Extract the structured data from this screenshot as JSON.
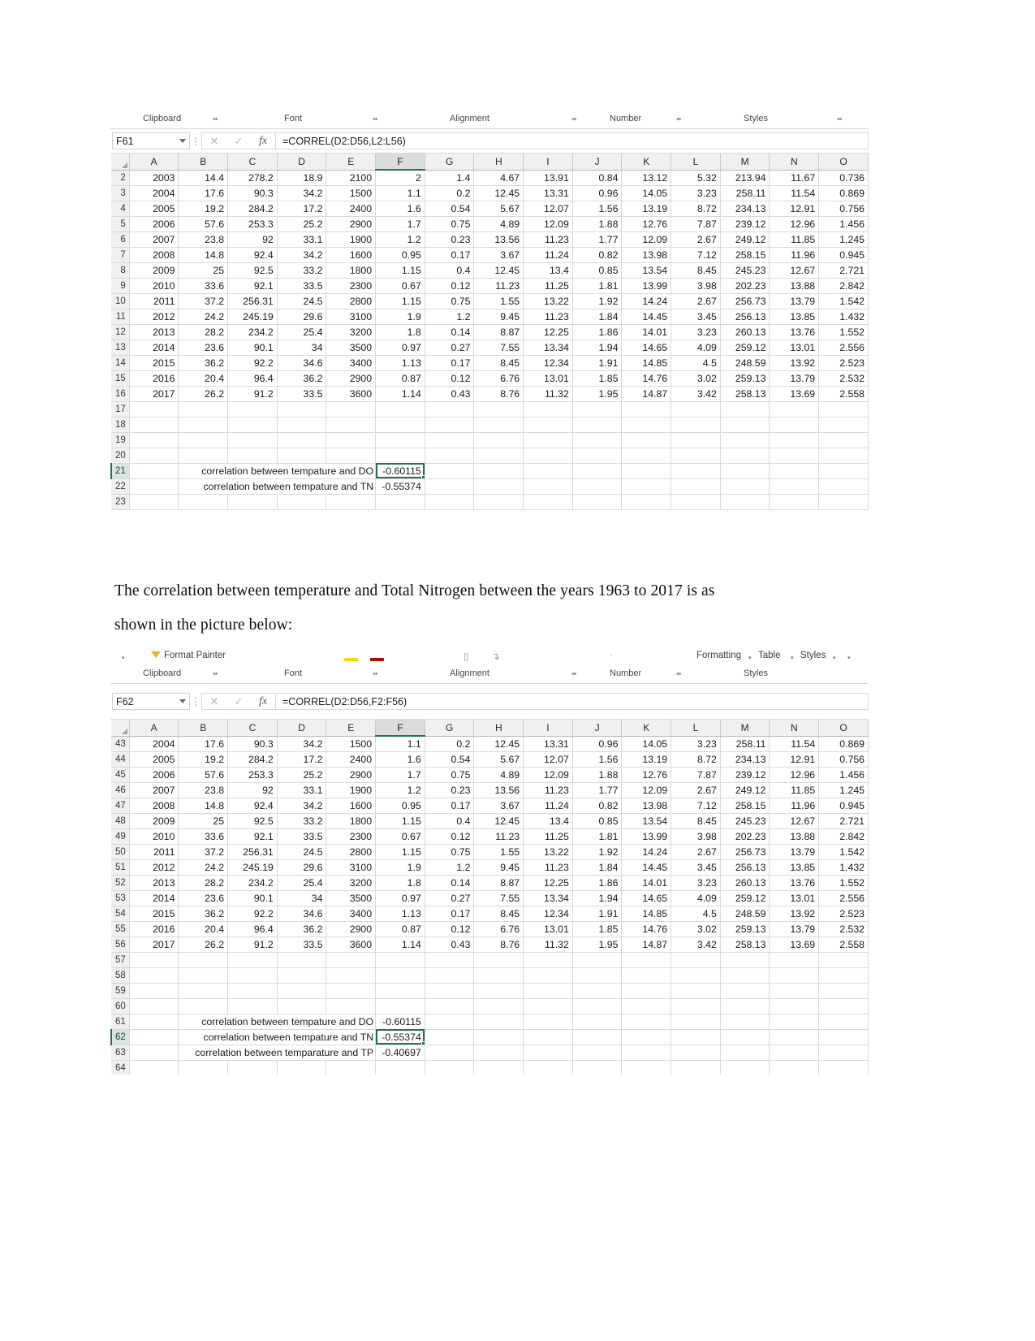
{
  "document": {
    "paragraph_line1": "The correlation between temperature and Total Nitrogen between the years 1963 to 2017 is as",
    "paragraph_line2": "shown in the picture below:"
  },
  "ribbon": {
    "group_clipboard": "Clipboard",
    "group_font": "Font",
    "group_alignment": "Alignment",
    "group_number": "Number",
    "group_styles": "Styles",
    "format_painter": "Format Painter",
    "conditional_formatting": "Formatting",
    "format_as_table": "Table",
    "cell_styles": "Styles",
    "launcher_glyph": "⬌",
    "caret_glyph": "▾",
    "colors": {
      "highlight_yellow": "#ffd400",
      "font_red": "#c00000",
      "accent_green": "#217346"
    }
  },
  "formula_bar": {
    "cancel_glyph": "✕",
    "confirm_glyph": "✓",
    "fx_glyph": "fx",
    "dots_glyph": "⋮"
  },
  "sheet1": {
    "name_box": "F61",
    "formula": "=CORREL(D2:D56,L2:L56)",
    "selected_column": "F",
    "columns": [
      "A",
      "B",
      "C",
      "D",
      "E",
      "F",
      "G",
      "H",
      "I",
      "J",
      "K",
      "L",
      "M",
      "N",
      "O"
    ],
    "row_numbers": [
      "2",
      "3",
      "4",
      "5",
      "6",
      "7",
      "8",
      "9",
      "10",
      "11",
      "12",
      "13",
      "14",
      "15",
      "16",
      "17",
      "18",
      "19",
      "20",
      "21",
      "22",
      "23"
    ],
    "rows": [
      [
        "2003",
        "14.4",
        "278.2",
        "18.9",
        "2100",
        "2",
        "1.4",
        "4.67",
        "13.91",
        "0.84",
        "13.12",
        "5.32",
        "213.94",
        "11.67",
        "0.736"
      ],
      [
        "2004",
        "17.6",
        "90.3",
        "34.2",
        "1500",
        "1.1",
        "0.2",
        "12.45",
        "13.31",
        "0.96",
        "14.05",
        "3.23",
        "258.11",
        "11.54",
        "0.869"
      ],
      [
        "2005",
        "19.2",
        "284.2",
        "17.2",
        "2400",
        "1.6",
        "0.54",
        "5.67",
        "12.07",
        "1.56",
        "13.19",
        "8.72",
        "234.13",
        "12.91",
        "0.756"
      ],
      [
        "2006",
        "57.6",
        "253.3",
        "25.2",
        "2900",
        "1.7",
        "0.75",
        "4.89",
        "12.09",
        "1.88",
        "12.76",
        "7.87",
        "239.12",
        "12.96",
        "1.456"
      ],
      [
        "2007",
        "23.8",
        "92",
        "33.1",
        "1900",
        "1.2",
        "0.23",
        "13.56",
        "11.23",
        "1.77",
        "12.09",
        "2.67",
        "249.12",
        "11.85",
        "1.245"
      ],
      [
        "2008",
        "14.8",
        "92.4",
        "34.2",
        "1600",
        "0.95",
        "0.17",
        "3.67",
        "11.24",
        "0.82",
        "13.98",
        "7.12",
        "258.15",
        "11.96",
        "0.945"
      ],
      [
        "2009",
        "25",
        "92.5",
        "33.2",
        "1800",
        "1.15",
        "0.4",
        "12.45",
        "13.4",
        "0.85",
        "13.54",
        "8.45",
        "245.23",
        "12.67",
        "2.721"
      ],
      [
        "2010",
        "33.6",
        "92.1",
        "33.5",
        "2300",
        "0.67",
        "0.12",
        "11.23",
        "11.25",
        "1.81",
        "13.99",
        "3.98",
        "202.23",
        "13.88",
        "2.842"
      ],
      [
        "2011",
        "37.2",
        "256.31",
        "24.5",
        "2800",
        "1.15",
        "0.75",
        "1.55",
        "13.22",
        "1.92",
        "14.24",
        "2.67",
        "256.73",
        "13.79",
        "1.542"
      ],
      [
        "2012",
        "24.2",
        "245.19",
        "29.6",
        "3100",
        "1.9",
        "1.2",
        "9.45",
        "11.23",
        "1.84",
        "14.45",
        "3.45",
        "256.13",
        "13.85",
        "1.432"
      ],
      [
        "2013",
        "28.2",
        "234.2",
        "25.4",
        "3200",
        "1.8",
        "0.14",
        "8.87",
        "12.25",
        "1.86",
        "14.01",
        "3.23",
        "260.13",
        "13.76",
        "1.552"
      ],
      [
        "2014",
        "23.6",
        "90.1",
        "34",
        "3500",
        "0.97",
        "0.27",
        "7.55",
        "13.34",
        "1.94",
        "14.65",
        "4.09",
        "259.12",
        "13.01",
        "2.556"
      ],
      [
        "2015",
        "36.2",
        "92.2",
        "34.6",
        "3400",
        "1.13",
        "0.17",
        "8.45",
        "12.34",
        "1.91",
        "14.85",
        "4.5",
        "248.59",
        "13.92",
        "2.523"
      ],
      [
        "2016",
        "20.4",
        "96.4",
        "36.2",
        "2900",
        "0.87",
        "0.12",
        "6.76",
        "13.01",
        "1.85",
        "14.76",
        "3.02",
        "259.13",
        "13.79",
        "2.532"
      ],
      [
        "2017",
        "26.2",
        "91.2",
        "33.5",
        "3600",
        "1.14",
        "0.43",
        "8.76",
        "11.32",
        "1.95",
        "14.87",
        "3.42",
        "258.13",
        "13.69",
        "2.558"
      ]
    ],
    "summary": [
      {
        "label": "correlation between tempature and DO",
        "value": "-0.60115",
        "selected": true
      },
      {
        "label": "correlation between tempature and TN",
        "value": "-0.55374",
        "selected": false
      }
    ]
  },
  "sheet2": {
    "name_box": "F62",
    "formula": "=CORREL(D2:D56,F2:F56)",
    "selected_column": "F",
    "columns": [
      "A",
      "B",
      "C",
      "D",
      "E",
      "F",
      "G",
      "H",
      "I",
      "J",
      "K",
      "L",
      "M",
      "N",
      "O"
    ],
    "row_numbers": [
      "43",
      "44",
      "45",
      "46",
      "47",
      "48",
      "49",
      "50",
      "51",
      "52",
      "53",
      "54",
      "55",
      "56",
      "57",
      "58",
      "59",
      "60",
      "61",
      "62",
      "63",
      "64"
    ],
    "rows": [
      [
        "2004",
        "17.6",
        "90.3",
        "34.2",
        "1500",
        "1.1",
        "0.2",
        "12.45",
        "13.31",
        "0.96",
        "14.05",
        "3.23",
        "258.11",
        "11.54",
        "0.869"
      ],
      [
        "2005",
        "19.2",
        "284.2",
        "17.2",
        "2400",
        "1.6",
        "0.54",
        "5.67",
        "12.07",
        "1.56",
        "13.19",
        "8.72",
        "234.13",
        "12.91",
        "0.756"
      ],
      [
        "2006",
        "57.6",
        "253.3",
        "25.2",
        "2900",
        "1.7",
        "0.75",
        "4.89",
        "12.09",
        "1.88",
        "12.76",
        "7.87",
        "239.12",
        "12.96",
        "1.456"
      ],
      [
        "2007",
        "23.8",
        "92",
        "33.1",
        "1900",
        "1.2",
        "0.23",
        "13.56",
        "11.23",
        "1.77",
        "12.09",
        "2.67",
        "249.12",
        "11.85",
        "1.245"
      ],
      [
        "2008",
        "14.8",
        "92.4",
        "34.2",
        "1600",
        "0.95",
        "0.17",
        "3.67",
        "11.24",
        "0.82",
        "13.98",
        "7.12",
        "258.15",
        "11.96",
        "0.945"
      ],
      [
        "2009",
        "25",
        "92.5",
        "33.2",
        "1800",
        "1.15",
        "0.4",
        "12.45",
        "13.4",
        "0.85",
        "13.54",
        "8.45",
        "245.23",
        "12.67",
        "2.721"
      ],
      [
        "2010",
        "33.6",
        "92.1",
        "33.5",
        "2300",
        "0.67",
        "0.12",
        "11.23",
        "11.25",
        "1.81",
        "13.99",
        "3.98",
        "202.23",
        "13.88",
        "2.842"
      ],
      [
        "2011",
        "37.2",
        "256.31",
        "24.5",
        "2800",
        "1.15",
        "0.75",
        "1.55",
        "13.22",
        "1.92",
        "14.24",
        "2.67",
        "256.73",
        "13.79",
        "1.542"
      ],
      [
        "2012",
        "24.2",
        "245.19",
        "29.6",
        "3100",
        "1.9",
        "1.2",
        "9.45",
        "11.23",
        "1.84",
        "14.45",
        "3.45",
        "256.13",
        "13.85",
        "1.432"
      ],
      [
        "2013",
        "28.2",
        "234.2",
        "25.4",
        "3200",
        "1.8",
        "0.14",
        "8.87",
        "12.25",
        "1.86",
        "14.01",
        "3.23",
        "260.13",
        "13.76",
        "1.552"
      ],
      [
        "2014",
        "23.6",
        "90.1",
        "34",
        "3500",
        "0.97",
        "0.27",
        "7.55",
        "13.34",
        "1.94",
        "14.65",
        "4.09",
        "259.12",
        "13.01",
        "2.556"
      ],
      [
        "2015",
        "36.2",
        "92.2",
        "34.6",
        "3400",
        "1.13",
        "0.17",
        "8.45",
        "12.34",
        "1.91",
        "14.85",
        "4.5",
        "248.59",
        "13.92",
        "2.523"
      ],
      [
        "2016",
        "20.4",
        "96.4",
        "36.2",
        "2900",
        "0.87",
        "0.12",
        "6.76",
        "13.01",
        "1.85",
        "14.76",
        "3.02",
        "259.13",
        "13.79",
        "2.532"
      ],
      [
        "2017",
        "26.2",
        "91.2",
        "33.5",
        "3600",
        "1.14",
        "0.43",
        "8.76",
        "11.32",
        "1.95",
        "14.87",
        "3.42",
        "258.13",
        "13.69",
        "2.558"
      ]
    ],
    "summary": [
      {
        "label": "correlation between tempature and DO",
        "value": "-0.60115",
        "selected": false
      },
      {
        "label": "correlation between tempature and TN",
        "value": "-0.55374",
        "selected": true
      },
      {
        "label": "correlation between temparature and TP",
        "value": "-0.40697",
        "selected": false
      }
    ]
  }
}
